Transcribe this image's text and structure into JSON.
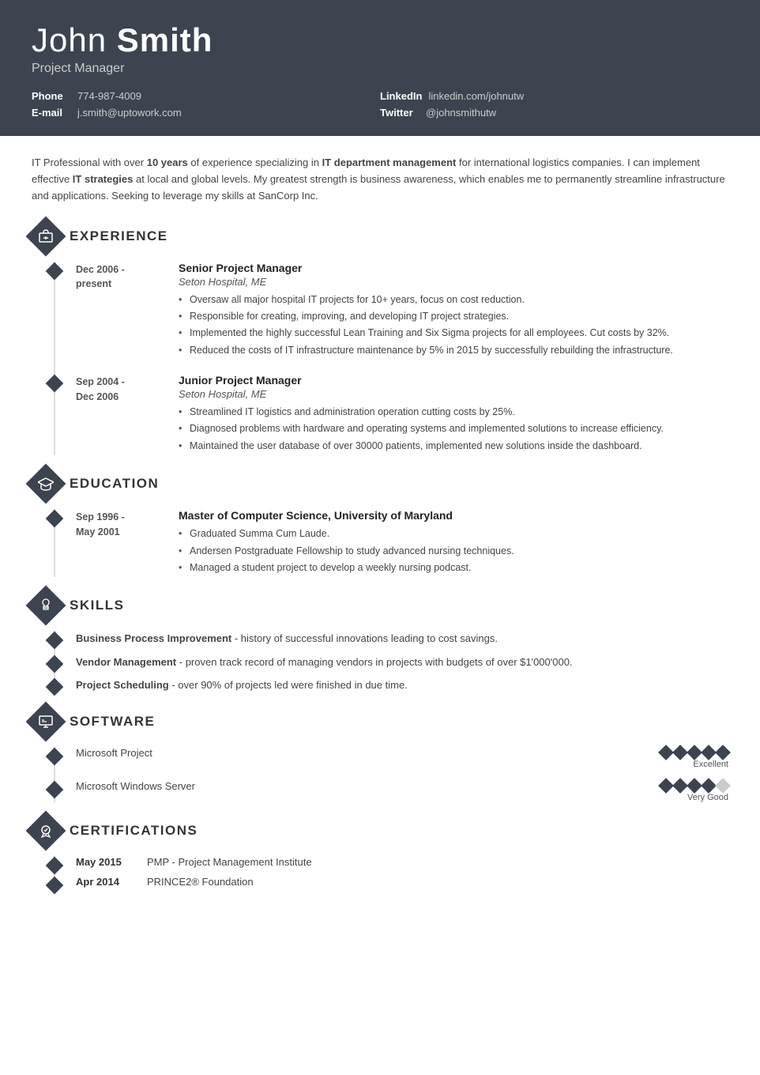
{
  "header": {
    "first_name": "John",
    "last_name": "Smith",
    "title": "Project Manager",
    "contacts": [
      {
        "label": "Phone",
        "value": "774-987-4009"
      },
      {
        "label": "LinkedIn",
        "value": "linkedin.com/johnutw"
      },
      {
        "label": "E-mail",
        "value": "j.smith@uptowork.com"
      },
      {
        "label": "Twitter",
        "value": "@johnsmithutw"
      }
    ]
  },
  "summary": {
    "text_parts": [
      {
        "text": "IT Professional with over ",
        "bold": false
      },
      {
        "text": "10 years",
        "bold": true
      },
      {
        "text": " of experience specializing in ",
        "bold": false
      },
      {
        "text": "IT department management",
        "bold": true
      },
      {
        "text": " for international logistics companies. I can implement effective ",
        "bold": false
      },
      {
        "text": "IT strategies",
        "bold": true
      },
      {
        "text": " at local and global levels. My greatest strength is business awareness, which enables me to permanently streamline infrastructure and applications. Seeking to leverage my skills at SanCorp Inc.",
        "bold": false
      }
    ]
  },
  "sections": {
    "experience": {
      "title": "EXPERIENCE",
      "items": [
        {
          "date_start": "Dec 2006 -",
          "date_end": "present",
          "job_title": "Senior Project Manager",
          "company": "Seton Hospital, ME",
          "bullets": [
            "Oversaw all major hospital IT projects for 10+ years, focus on cost reduction.",
            "Responsible for creating, improving, and developing IT project strategies.",
            "Implemented the highly successful Lean Training and Six Sigma projects for all employees. Cut costs by 32%.",
            "Reduced the costs of IT infrastructure maintenance by 5% in 2015 by successfully rebuilding the infrastructure."
          ]
        },
        {
          "date_start": "Sep 2004 -",
          "date_end": "Dec 2006",
          "job_title": "Junior Project Manager",
          "company": "Seton Hospital, ME",
          "bullets": [
            "Streamlined IT logistics and administration operation cutting costs by 25%.",
            "Diagnosed problems with hardware and operating systems and implemented solutions to increase efficiency.",
            "Maintained the user database of over 30000 patients, implemented new solutions inside the dashboard."
          ]
        }
      ]
    },
    "education": {
      "title": "EDUCATION",
      "items": [
        {
          "date_start": "Sep 1996 -",
          "date_end": "May 2001",
          "degree": "Master of Computer Science, University of Maryland",
          "bullets": [
            "Graduated Summa Cum Laude.",
            "Andersen Postgraduate Fellowship to study advanced nursing techniques.",
            "Managed a student project to develop a weekly nursing podcast."
          ]
        }
      ]
    },
    "skills": {
      "title": "SKILLS",
      "items": [
        {
          "name": "Business Process Improvement",
          "description": " - history of successful innovations leading to cost savings."
        },
        {
          "name": "Vendor Management",
          "description": " - proven track record of managing vendors in projects with budgets of over $1'000'000."
        },
        {
          "name": "Project Scheduling",
          "description": " - over 90% of projects led were finished in due time."
        }
      ]
    },
    "software": {
      "title": "SOFTWARE",
      "items": [
        {
          "name": "Microsoft Project",
          "rating": 5,
          "max": 5,
          "label": "Excellent"
        },
        {
          "name": "Microsoft Windows Server",
          "rating": 4,
          "max": 5,
          "label": "Very Good"
        }
      ]
    },
    "certifications": {
      "title": "CERTIFICATIONS",
      "items": [
        {
          "date": "May 2015",
          "name": "PMP - Project Management Institute"
        },
        {
          "date": "Apr 2014",
          "name": "PRINCE2® Foundation"
        }
      ]
    }
  }
}
